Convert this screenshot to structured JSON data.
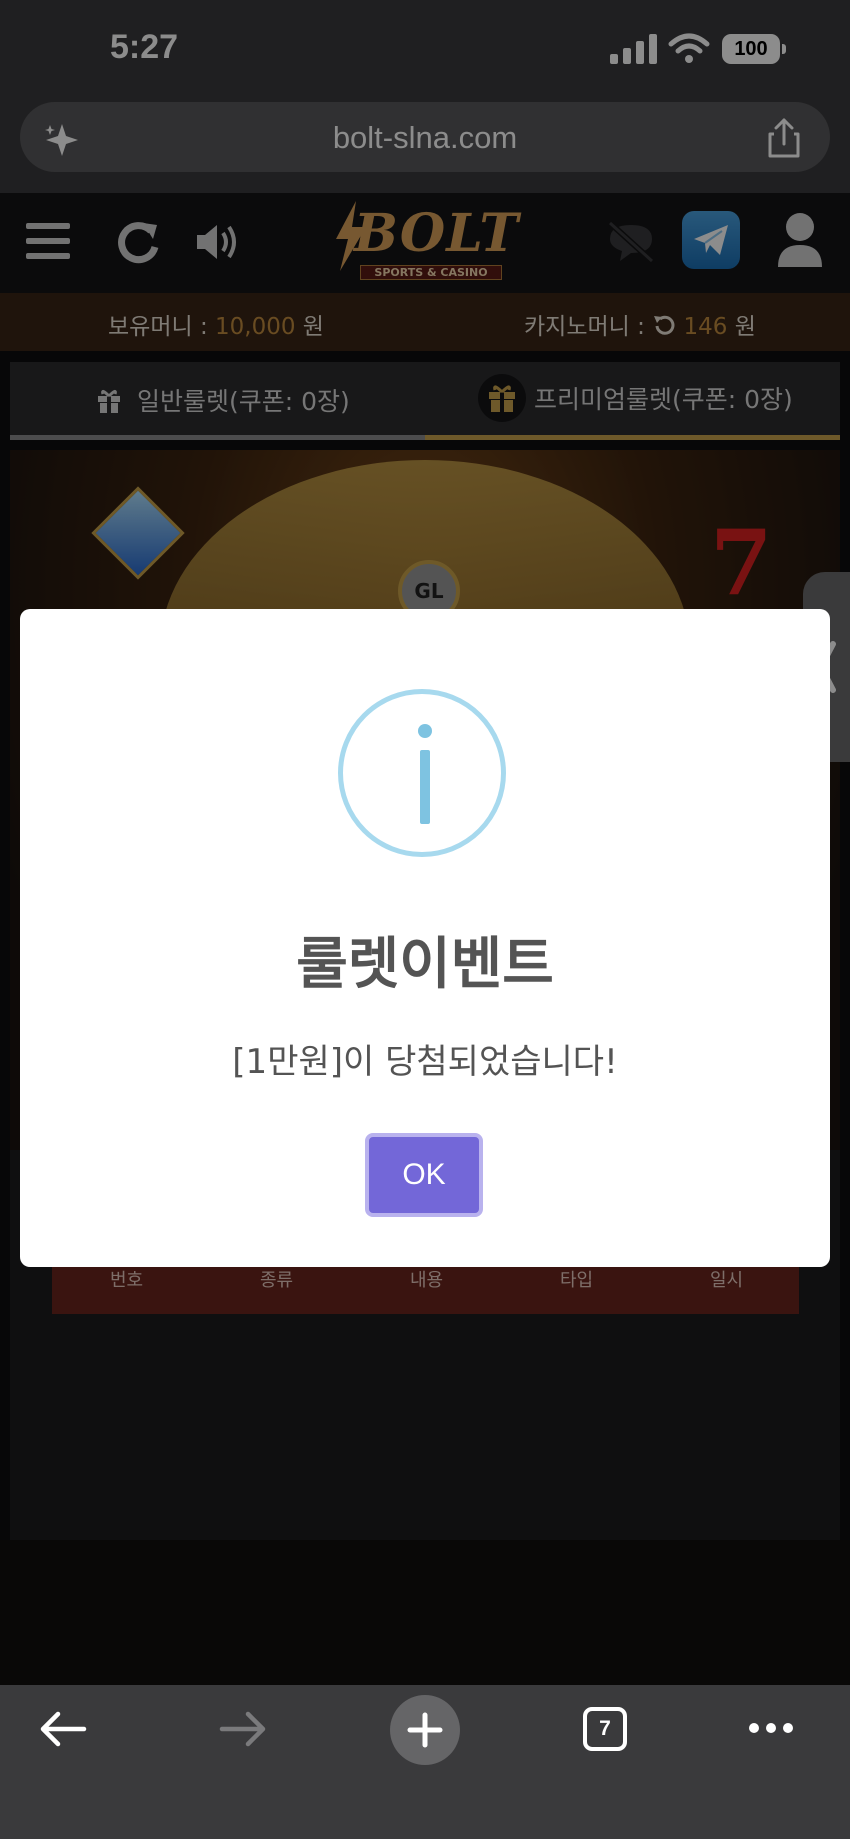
{
  "status_bar": {
    "time": "5:27",
    "battery": "100"
  },
  "browser": {
    "url": "bolt-slna.com",
    "tab_count": "7"
  },
  "site": {
    "logo_text": "BOLT",
    "logo_sub": "SPORTS & CASINO",
    "money_label": "보유머니 : ",
    "money_value": "10,000",
    "money_unit": " 원",
    "casino_label": "카지노머니 : ",
    "casino_value": "146",
    "casino_unit": " 원"
  },
  "tabs": [
    {
      "label": "일반룰렛(쿠폰: 0장)"
    },
    {
      "label": "프리미엄룰렛(쿠폰: 0장)"
    }
  ],
  "table": {
    "headers": [
      "번호",
      "종류",
      "내용",
      "타입",
      "일시"
    ]
  },
  "game": {
    "badge": "GL"
  },
  "dialog": {
    "title": "룰렛이벤트",
    "message": "[1만원]이 당첨되었습니다!",
    "ok_label": "OK"
  },
  "colors": {
    "accent_gold": "#c08a3e",
    "ok_button": "#7367d8",
    "info_icon": "#7ec3e1"
  }
}
